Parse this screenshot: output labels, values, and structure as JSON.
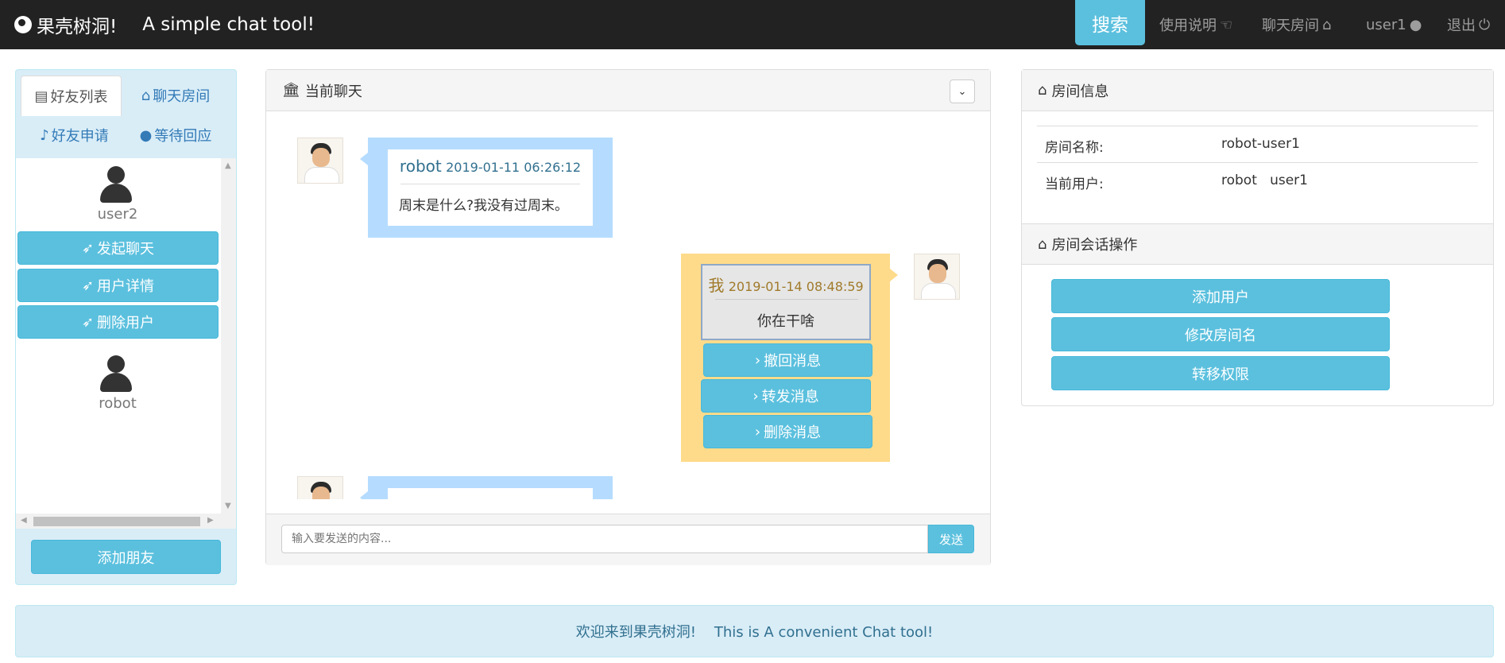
{
  "navbar": {
    "brand": "果壳树洞!",
    "subtitle": "A simple chat tool!",
    "search_label": "搜索",
    "items": [
      {
        "label": "使用说明",
        "icon": "hand-pointer-icon"
      },
      {
        "label": "聊天房间",
        "icon": "home-icon"
      },
      {
        "label": "user1",
        "icon": "user-icon"
      },
      {
        "label": "退出",
        "icon": "power-icon"
      }
    ]
  },
  "left": {
    "tabs": [
      "好友列表",
      "聊天房间",
      "好友申请",
      "等待回应"
    ],
    "friends": [
      {
        "name": "user2",
        "actions": [
          "发起聊天",
          "用户详情",
          "删除用户"
        ]
      },
      {
        "name": "robot"
      }
    ],
    "add_friend": "添加朋友"
  },
  "chat": {
    "title": "当前聊天",
    "messages": [
      {
        "sender": "robot",
        "time": "2019-01-11 06:26:12",
        "text": "周末是什么?我没有过周末。"
      },
      {
        "sender": "我",
        "time": "2019-01-14 08:48:59",
        "text": "你在干啥",
        "actions": [
          "撤回消息",
          "转发消息",
          "删除消息"
        ]
      }
    ],
    "input_placeholder": "输入要发送的内容...",
    "send_label": "发送"
  },
  "room": {
    "info_title": "房间信息",
    "rows": [
      {
        "label": "房间名称:",
        "value": "robot-user1"
      },
      {
        "label": "当前用户:",
        "value": "robot   user1"
      }
    ],
    "ops_title": "房间会话操作",
    "ops": [
      "添加用户",
      "修改房间名",
      "转移权限"
    ]
  },
  "footer": {
    "text": "欢迎来到果壳树洞!    This is A convenient Chat tool!"
  },
  "colors": {
    "navbar": "#222222",
    "info": "#5bc0de",
    "blue_bubble": "#b5dcff",
    "yellow_bubble": "#fedb8b",
    "alert_bg": "#d9edf7"
  }
}
